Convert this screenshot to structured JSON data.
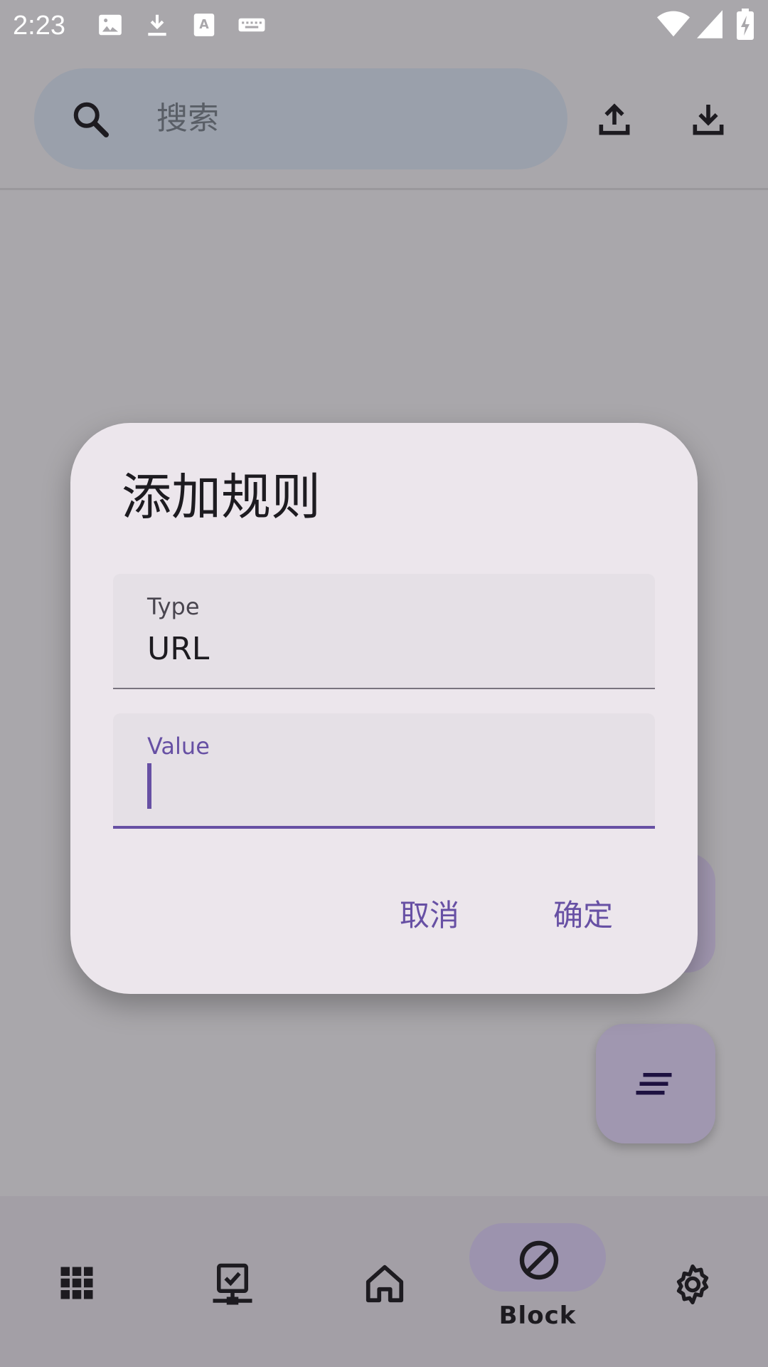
{
  "status_bar": {
    "time": "2:23",
    "left_icons": [
      "image-icon",
      "download-icon",
      "text-recognition-icon",
      "keyboard-icon"
    ],
    "right_icons": [
      "wifi-icon",
      "signal-icon",
      "battery-charging-icon"
    ]
  },
  "search": {
    "placeholder": "搜索"
  },
  "top_actions": [
    "upload-icon",
    "download-icon"
  ],
  "dialog": {
    "title": "添加规则",
    "type_field": {
      "label": "Type",
      "value": "URL"
    },
    "value_field": {
      "label": "Value",
      "value": ""
    },
    "cancel_label": "取消",
    "confirm_label": "确定"
  },
  "fab": {
    "icon": "sort-icon"
  },
  "bottom_nav": {
    "items": [
      {
        "icon": "apps-grid-icon",
        "label": ""
      },
      {
        "icon": "network-check-icon",
        "label": ""
      },
      {
        "icon": "home-icon",
        "label": ""
      },
      {
        "icon": "block-icon",
        "label": "Block",
        "active": true
      },
      {
        "icon": "settings-icon",
        "label": ""
      }
    ]
  },
  "colors": {
    "scrim_background": "#a9a7ab",
    "dialog_surface": "#ece6ec",
    "primary": "#6750a4",
    "on_surface": "#1d1b20"
  }
}
